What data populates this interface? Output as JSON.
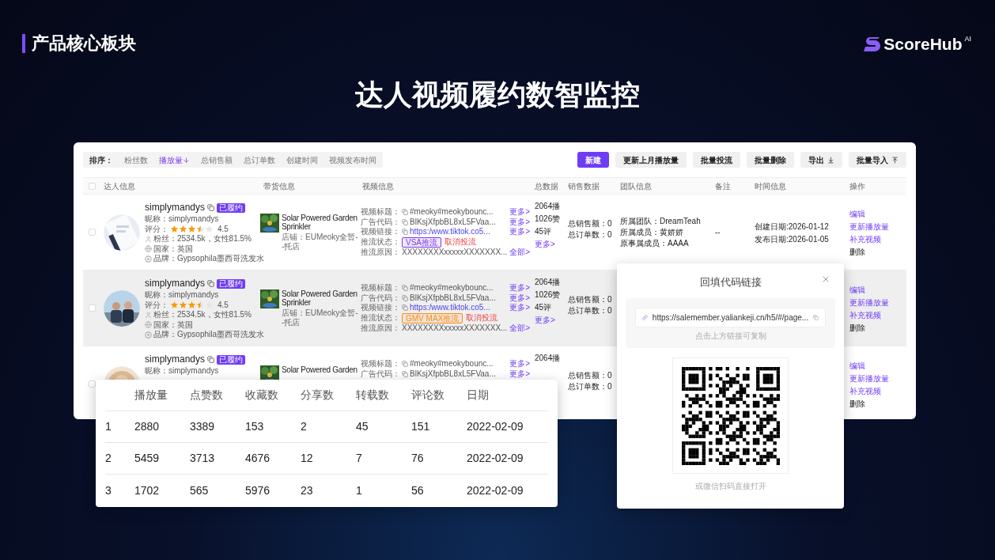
{
  "header": {
    "section_label": "产品核心板块",
    "logo": "ScoreHub",
    "logo_sup": "AI"
  },
  "title": "达人视频履约数智监控",
  "sort_bar": {
    "label": "排序：",
    "options": [
      {
        "label": "粉丝数",
        "selected": false
      },
      {
        "label": "播放量",
        "selected": true
      },
      {
        "label": "总销售额",
        "selected": false
      },
      {
        "label": "总订单数",
        "selected": false
      },
      {
        "label": "创建时间",
        "selected": false
      },
      {
        "label": "视频发布时间",
        "selected": false
      }
    ]
  },
  "toolbar_buttons": [
    {
      "label": "新建",
      "kind": "primary"
    },
    {
      "label": "更新上月播放量",
      "kind": "plain"
    },
    {
      "label": "批量投流",
      "kind": "plain"
    },
    {
      "label": "批量删除",
      "kind": "plain"
    },
    {
      "label": "导出",
      "kind": "export"
    },
    {
      "label": "批量导入",
      "kind": "import"
    }
  ],
  "table": {
    "header_checked": false,
    "columns": [
      "达人信息",
      "带货信息",
      "视频信息",
      "总数据",
      "销售数据",
      "团队信息",
      "备注",
      "时间信息",
      "操作"
    ],
    "rows": [
      {
        "checked": false,
        "highlighted": false,
        "name": "simplymandys",
        "badge": "已履约",
        "nickname": "昵称：simplymandys",
        "rating_label": "评分：",
        "stars": 3.5,
        "rating": "4.5",
        "fans": "粉丝：2534.5k，女性81.5%",
        "country": "国家：英国",
        "brand": "品牌：Gypsophila墨西哥洗发水",
        "product": "Solar Powered Garden Sprinkler",
        "shop": "店铺：EUMeoky全暂--托店",
        "video": [
          {
            "kind": "copy",
            "label": "视频标题：",
            "value": "#meoky#meokybounc...",
            "more": "更多>"
          },
          {
            "kind": "copy",
            "label": "广告代码：",
            "value": "BlKsjXfpbBL8xL5FVaa...",
            "more": "更多>"
          },
          {
            "kind": "link",
            "label": "视频链接：",
            "value": "https:/www.tiktok.co5...",
            "more": "更多>"
          },
          {
            "kind": "status",
            "label": "推流状态：",
            "tag": "VSA推流",
            "color": "#7c3aed",
            "action": "取消投流"
          },
          {
            "kind": "text",
            "label": "推流原因：",
            "value": "XXXXXXXXxxxxxXXXXXXX...",
            "more": "全部>"
          }
        ],
        "totals": [
          "2064播",
          "1026赞",
          "45评"
        ],
        "totals_more": "更多>",
        "sales": [
          "总销售额：0",
          "总订单数：0"
        ],
        "team": [
          "所属团队：DreamTeah",
          "所属成员：黄娇娇",
          "原事属成员：AAAA"
        ],
        "note": "--",
        "times": [
          "创建日期:2026-01-12",
          "发布日期:2026-01-05"
        ],
        "actions": [
          {
            "label": "编辑",
            "kind": "link"
          },
          {
            "label": "更新播放量",
            "kind": "link"
          },
          {
            "label": "补充视频",
            "kind": "link"
          },
          {
            "label": "删除",
            "kind": "plain"
          }
        ]
      },
      {
        "checked": false,
        "highlighted": true,
        "name": "simplymandys",
        "badge": "已履约",
        "nickname": "昵称：simplymandys",
        "rating_label": "评分：",
        "stars": 3.5,
        "rating": "4.5",
        "fans": "粉丝：2534.5k，女性81.5%",
        "country": "国家：英国",
        "brand": "品牌：Gypsophila墨西哥洗发水",
        "product": "Solar Powered Garden Sprinkler",
        "shop": "店铺：EUMeoky全暂--托店",
        "video": [
          {
            "kind": "copy",
            "label": "视频标题：",
            "value": "#meoky#meokybounc...",
            "more": "更多>"
          },
          {
            "kind": "copy",
            "label": "广告代码：",
            "value": "BlKsjXfpbBL8xL5FVaa...",
            "more": "更多>"
          },
          {
            "kind": "link",
            "label": "视频链接：",
            "value": "https:/www.tiktok.co5...",
            "more": "更多>"
          },
          {
            "kind": "status",
            "label": "推流状态：",
            "tag": "GMV MAX推流",
            "color": "#fa8c16",
            "action": "取消投流"
          },
          {
            "kind": "text",
            "label": "推流原因：",
            "value": "XXXXXXXXxxxxxXXXXXXX...",
            "more": "全部>"
          }
        ],
        "totals": [
          "2064播",
          "1026赞",
          "45评"
        ],
        "totals_more": "更多>",
        "sales": [
          "总销售额：0",
          "总订单数：0"
        ],
        "actions": [
          {
            "label": "编辑",
            "kind": "link"
          },
          {
            "label": "更新播放量",
            "kind": "link"
          },
          {
            "label": "补充视频",
            "kind": "link"
          },
          {
            "label": "删除",
            "kind": "plain"
          }
        ]
      },
      {
        "checked": false,
        "highlighted": false,
        "name": "simplymandys",
        "badge": "已履约",
        "nickname": "昵称：simplymandys",
        "product": "Solar Powered Garden",
        "video": [
          {
            "kind": "copy",
            "label": "视频标题：",
            "value": "#meoky#meokybounc...",
            "more": "更多>"
          },
          {
            "kind": "copy",
            "label": "广告代码：",
            "value": "BlKsjXfpbBL8xL5FVaa...",
            "more": "更多>"
          }
        ],
        "totals": [
          "2064播"
        ],
        "sales": [
          "总销售额：0",
          "总订单数：0"
        ],
        "actions": [
          {
            "label": "编辑",
            "kind": "link"
          },
          {
            "label": "更新播放量",
            "kind": "link"
          },
          {
            "label": "补充视频",
            "kind": "link"
          },
          {
            "label": "删除",
            "kind": "plain"
          }
        ]
      }
    ]
  },
  "stats_table": {
    "columns": [
      "",
      "播放量",
      "点赞数",
      "收藏数",
      "分享数",
      "转载数",
      "评论数",
      "日期"
    ],
    "rows": [
      [
        "1",
        "2880",
        "3389",
        "153",
        "2",
        "45",
        "151",
        "2022-02-09"
      ],
      [
        "2",
        "5459",
        "3713",
        "4676",
        "12",
        "7",
        "76",
        "2022-02-09"
      ],
      [
        "3",
        "1702",
        "565",
        "5976",
        "23",
        "1",
        "56",
        "2022-02-09"
      ]
    ]
  },
  "qr_modal": {
    "title": "回填代码链接",
    "link": "https://salemember.yaliankeji.cn/h5/#/page...",
    "hint": "点击上方链接可复制",
    "caption": "或微信扫码直接打开"
  }
}
